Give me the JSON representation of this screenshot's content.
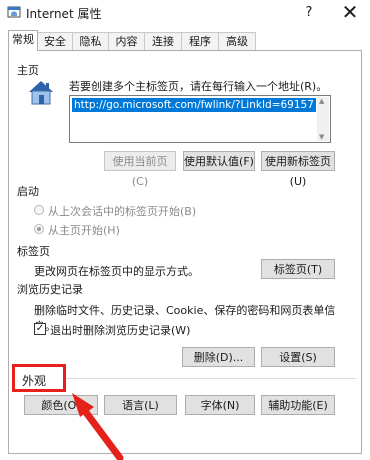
{
  "window": {
    "title": "Internet 属性",
    "help_label": "?",
    "close_label": "✕"
  },
  "tabs": [
    {
      "label": "常规"
    },
    {
      "label": "安全"
    },
    {
      "label": "隐私"
    },
    {
      "label": "内容"
    },
    {
      "label": "连接"
    },
    {
      "label": "程序"
    },
    {
      "label": "高级"
    }
  ],
  "homepage": {
    "section_label": "主页",
    "description": "若要创建多个主标签页，请在每行输入一个地址(R)。",
    "url_value": "http://go.microsoft.com/fwlink/?LinkId=69157",
    "use_current_label": "使用当前页(C)",
    "use_default_label": "使用默认值(F)",
    "use_new_tab_label": "使用新标签页(U)"
  },
  "startup": {
    "section_label": "启动",
    "option_last_session": "从上次会话中的标签页开始(B)",
    "option_home_page": "从主页开始(H)"
  },
  "tabs_section": {
    "section_label": "标签页",
    "description": "更改网页在标签页中的显示方式。",
    "tabs_button_label": "标签页(T)"
  },
  "history": {
    "section_label": "浏览历史记录",
    "description": "删除临时文件、历史记录、Cookie、保存的密码和网页表单信息。",
    "delete_on_exit_label": "退出时删除浏览历史记录(W)",
    "delete_on_exit_checked": true,
    "checkmark": "✓",
    "delete_button_label": "删除(D)...",
    "settings_button_label": "设置(S)"
  },
  "appearance": {
    "section_label": "外观",
    "colors_label": "颜色(O)",
    "languages_label": "语言(L)",
    "fonts_label": "字体(N)",
    "accessibility_label": "辅助功能(E)"
  },
  "colors": {
    "highlight": "#e5211b",
    "selection": "#0078d7"
  }
}
